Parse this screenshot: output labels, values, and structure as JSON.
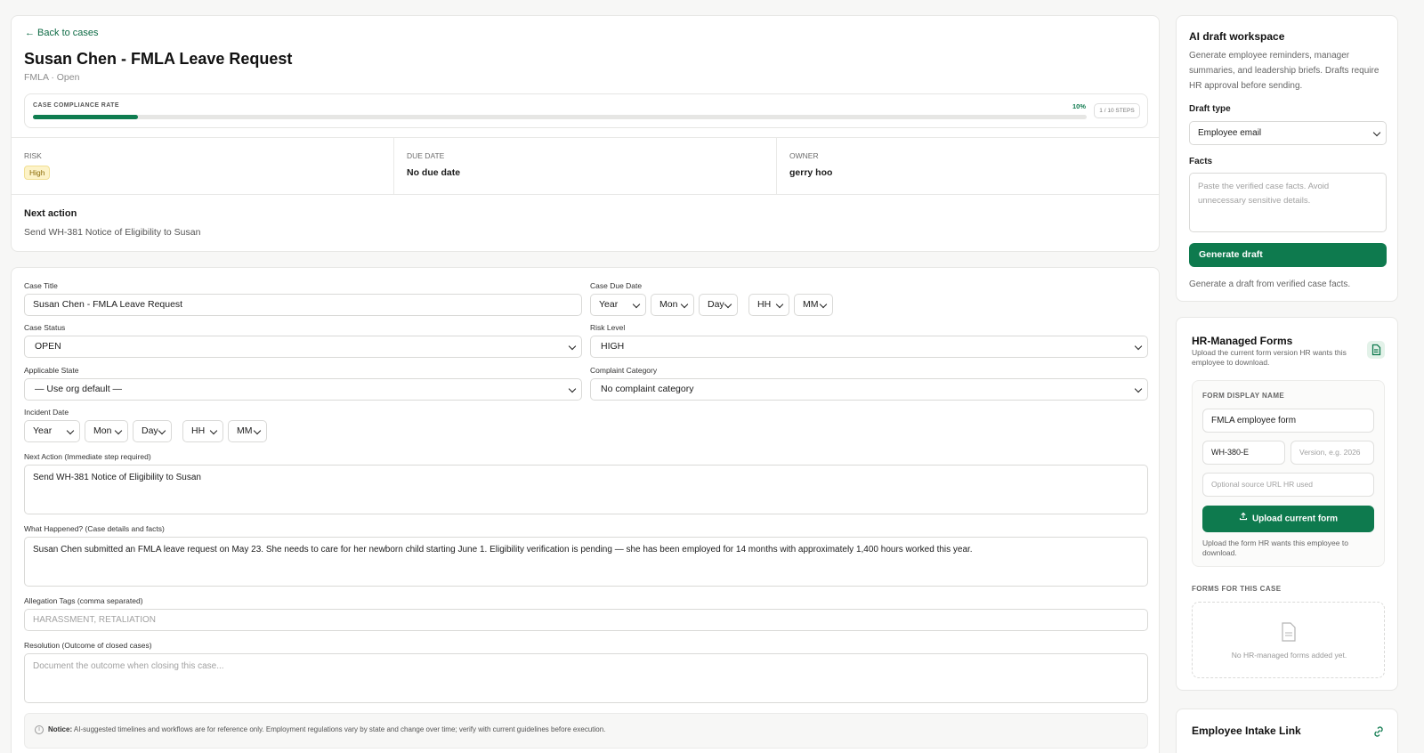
{
  "summary": {
    "back_label": "← Back to cases",
    "title": "Susan Chen - FMLA Leave Request",
    "subtitle": "FMLA · Open",
    "compliance": {
      "label": "CASE COMPLIANCE RATE",
      "percent_label": "10%",
      "percent": 10,
      "steps": "1 / 10 STEPS"
    },
    "risk": {
      "label": "RISK",
      "value": "High"
    },
    "due": {
      "label": "DUE DATE",
      "value": "No due date"
    },
    "owner": {
      "label": "OWNER",
      "value": "gerry hoo"
    },
    "next_action": {
      "label": "Next action",
      "value": "Send WH-381 Notice of Eligibility to Susan"
    }
  },
  "form": {
    "case_title": {
      "label": "Case Title",
      "value": "Susan Chen - FMLA Leave Request"
    },
    "case_due_date": {
      "label": "Case Due Date",
      "year": "Year",
      "mon": "Mon",
      "day": "Day",
      "hh": "HH",
      "mm": "MM"
    },
    "case_status": {
      "label": "Case Status",
      "value": "OPEN"
    },
    "risk_level": {
      "label": "Risk Level",
      "value": "HIGH"
    },
    "applicable_state": {
      "label": "Applicable State",
      "value": "— Use org default —"
    },
    "complaint_category": {
      "label": "Complaint Category",
      "value": "No complaint category"
    },
    "incident_date": {
      "label": "Incident Date",
      "year": "Year",
      "mon": "Mon",
      "day": "Day",
      "hh": "HH",
      "mm": "MM"
    },
    "next_action": {
      "label": "Next Action (Immediate step required)",
      "value": "Send WH-381 Notice of Eligibility to Susan"
    },
    "what_happened": {
      "label": "What Happened? (Case details and facts)",
      "value": "Susan Chen submitted an FMLA leave request on May 23. She needs to care for her newborn child starting June 1. Eligibility verification is pending — she has been employed for 14 months with approximately 1,400 hours worked this year."
    },
    "allegation_tags": {
      "label": "Allegation Tags (comma separated)",
      "placeholder": "HARASSMENT, RETALIATION"
    },
    "resolution": {
      "label": "Resolution (Outcome of closed cases)",
      "placeholder": "Document the outcome when closing this case..."
    },
    "notice": {
      "bold": "Notice:",
      "text": " AI-suggested timelines and workflows are for reference only. Employment regulations vary by state and change over time; verify with current guidelines before execution."
    }
  },
  "ai": {
    "title": "AI draft workspace",
    "description": "Generate employee reminders, manager summaries, and leadership briefs. Drafts require HR approval before sending.",
    "draft_type_label": "Draft type",
    "draft_type_value": "Employee email",
    "facts_label": "Facts",
    "facts_placeholder": "Paste the verified case facts. Avoid unnecessary sensitive details.",
    "generate_label": "Generate draft",
    "hint": "Generate a draft from verified case facts."
  },
  "forms": {
    "title": "HR-Managed Forms",
    "description": "Upload the current form version HR wants this employee to download.",
    "display_name_caption": "FORM DISPLAY NAME",
    "display_name_value": "FMLA employee form",
    "form_code": "WH-380-E",
    "version_placeholder": "Version, e.g. 2026",
    "source_url_placeholder": "Optional source URL HR used",
    "upload_label": "Upload current form",
    "upload_hint": "Upload the form HR wants this employee to download.",
    "list_caption": "FORMS FOR THIS CASE",
    "empty_text": "No HR-managed forms added yet."
  },
  "intake": {
    "title": "Employee Intake Link"
  },
  "colors": {
    "accent": "#0e7a4e",
    "risk_badge_bg": "#fdf3c8"
  }
}
